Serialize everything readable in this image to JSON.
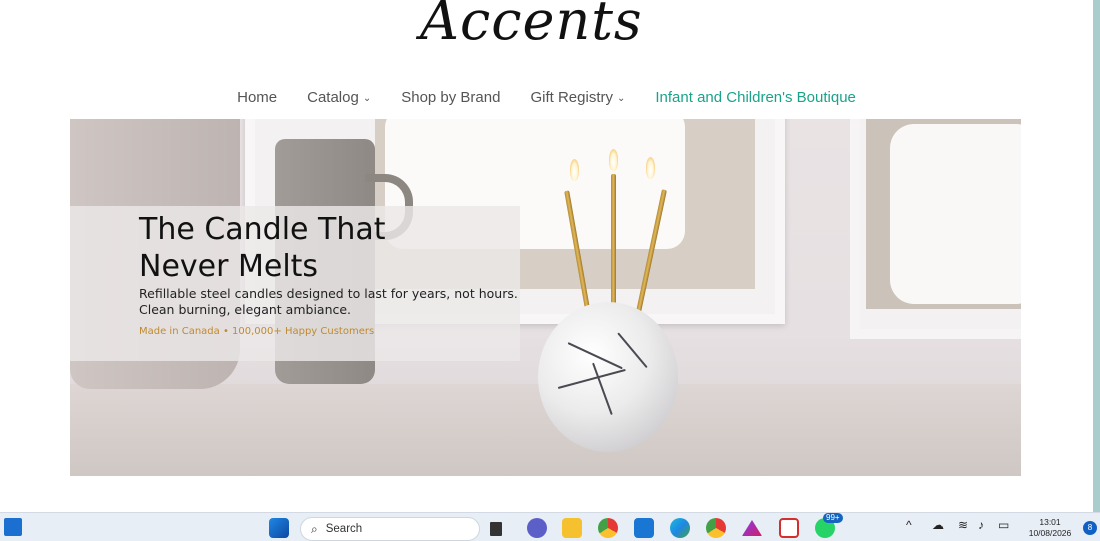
{
  "site": {
    "logo_text": "Accents"
  },
  "nav": {
    "items": [
      {
        "label": "Home",
        "has_dropdown": false
      },
      {
        "label": "Catalog",
        "has_dropdown": true
      },
      {
        "label": "Shop by Brand",
        "has_dropdown": false
      },
      {
        "label": "Gift Registry",
        "has_dropdown": true
      },
      {
        "label": "Infant and Children's Boutique",
        "has_dropdown": false,
        "highlighted": true
      }
    ],
    "dropdown_glyph": "⌄",
    "accent_color": "#1aa38a"
  },
  "hero": {
    "title_line1": "The Candle That",
    "title_line2": "Never Melts",
    "subtitle_line1": "Refillable steel candles designed to last for years, not hours.",
    "subtitle_line2": "Clean burning, elegant ambiance.",
    "tagline": "Made in Canada • 100,000+ Happy Customers",
    "tagline_color": "#c08a2e"
  },
  "taskbar": {
    "search_placeholder": "Search",
    "apps": [
      "start-icon",
      "file-icon",
      "teams-icon",
      "file-explorer-icon",
      "chrome-icon",
      "microsoft-store-icon",
      "edge-icon",
      "chrome-profile-icon",
      "affinity-icon",
      "snipping-tool-icon",
      "whatsapp-icon"
    ],
    "whatsapp_badge": "99+",
    "time": "13:01",
    "date": "10/08/2026",
    "notification_count": "8"
  }
}
